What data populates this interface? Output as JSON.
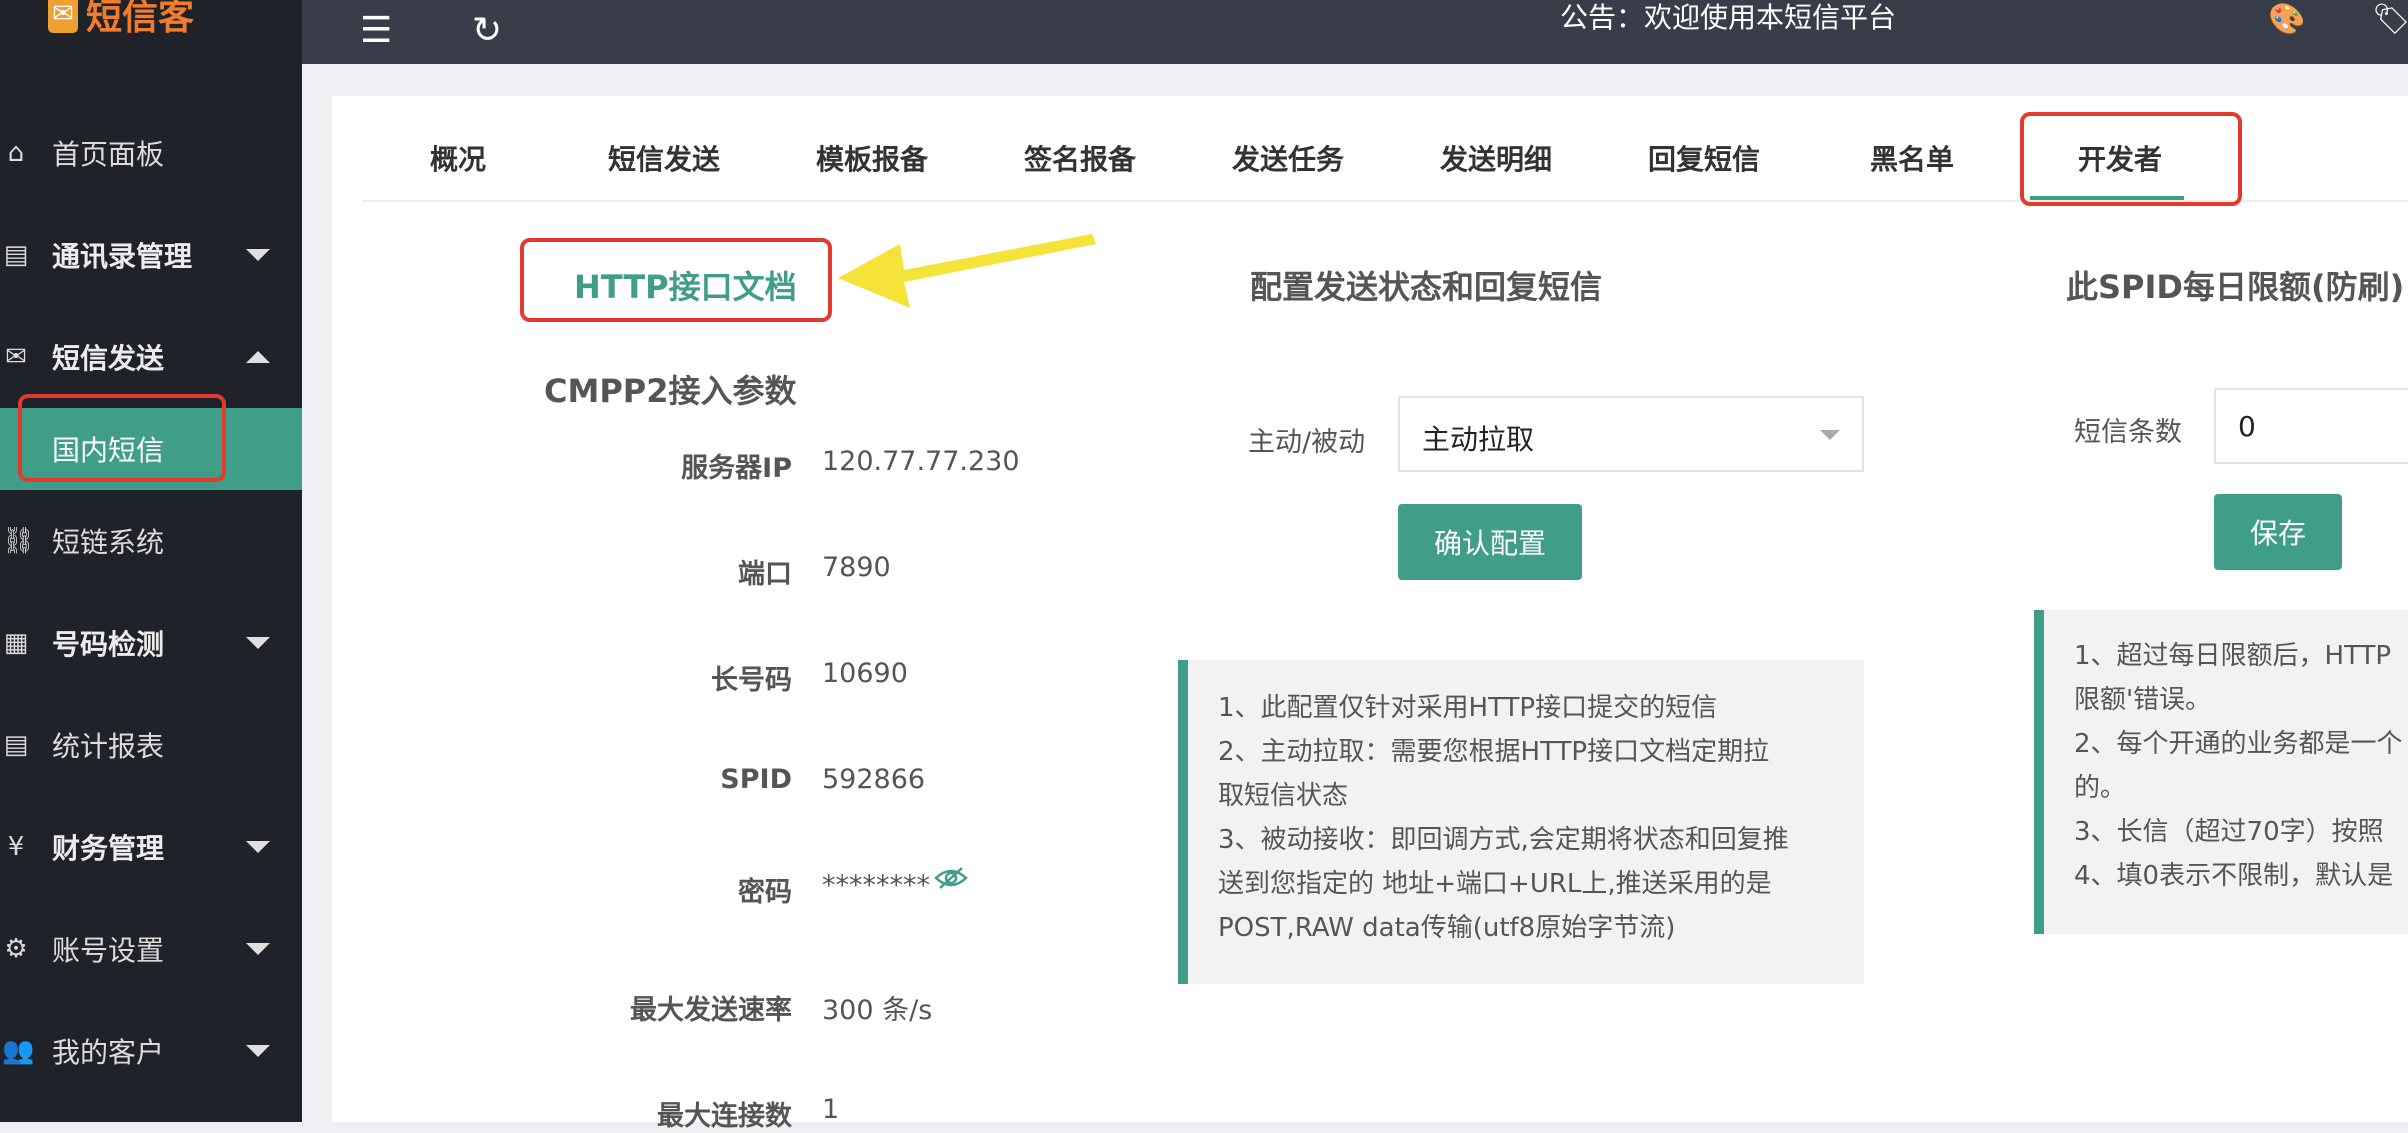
{
  "sidebar": {
    "logo_text": "短信客",
    "logo_mark": "✉",
    "items": [
      {
        "label": "首页面板",
        "icon": "home-icon",
        "glyph": "⌂"
      },
      {
        "label": "通讯录管理",
        "icon": "contacts-icon",
        "glyph": "▤"
      },
      {
        "label": "短信发送",
        "icon": "mail-icon",
        "glyph": "✉"
      },
      {
        "label": "国内短信"
      },
      {
        "label": "短链系统",
        "icon": "link-icon",
        "glyph": "⛓"
      },
      {
        "label": "号码检测",
        "icon": "detect-icon",
        "glyph": "▦"
      },
      {
        "label": "统计报表",
        "icon": "report-icon",
        "glyph": "▤"
      },
      {
        "label": "财务管理",
        "icon": "yen-icon",
        "glyph": "¥"
      },
      {
        "label": "账号设置",
        "icon": "gear-icon",
        "glyph": "⚙"
      },
      {
        "label": "我的客户",
        "icon": "user-group-icon",
        "glyph": "👥"
      }
    ]
  },
  "topbar": {
    "notice": "公告：欢迎使用本短信平台",
    "icons": {
      "menu": "☰",
      "refresh": "↻",
      "palette": "🎨",
      "tag": "🏷"
    }
  },
  "tabs": [
    "概况",
    "短信发送",
    "模板报备",
    "签名报备",
    "发送任务",
    "发送明细",
    "回复短信",
    "黑名单",
    "开发者"
  ],
  "developer": {
    "doc_link": "HTTP接口文档",
    "cmpp_title": "CMPP2接入参数",
    "params": [
      {
        "label": "服务器IP",
        "value": "120.77.77.230"
      },
      {
        "label": "端口",
        "value": "7890"
      },
      {
        "label": "长号码",
        "value": "10690"
      },
      {
        "label": "SPID",
        "value": "592866"
      },
      {
        "label": "密码",
        "value": "********"
      },
      {
        "label": "最大发送速率",
        "value": "300 条/s"
      },
      {
        "label": "最大连接数",
        "value": "1"
      }
    ]
  },
  "config": {
    "title": "配置发送状态和回复短信",
    "mode_label": "主动/被动",
    "mode_value": "主动拉取",
    "confirm_button": "确认配置",
    "notes": [
      "1、此配置仅针对采用HTTP接口提交的短信",
      "2、主动拉取：需要您根据HTTP接口文档定期拉",
      "取短信状态",
      "3、被动接收：即回调方式,会定期将状态和回复推",
      "送到您指定的 地址+端口+URL上,推送采用的是",
      "POST,RAW data传输(utf8原始字节流)"
    ]
  },
  "limit": {
    "title": "此SPID每日限额(防刷)",
    "count_label": "短信条数",
    "count_value": "0",
    "save_button": "保存",
    "notes": [
      "1、超过每日限额后，HTTP",
      "限额'错误。",
      "2、每个开通的业务都是一个",
      "的。",
      "3、长信（超过70字）按照",
      "4、填0表示不限制，默认是"
    ]
  },
  "colors": {
    "accent": "#3f9d88",
    "highlight": "#e23a2b",
    "arrow": "#f5e33a",
    "sidebar": "#20222a",
    "topbar": "#393d49"
  }
}
